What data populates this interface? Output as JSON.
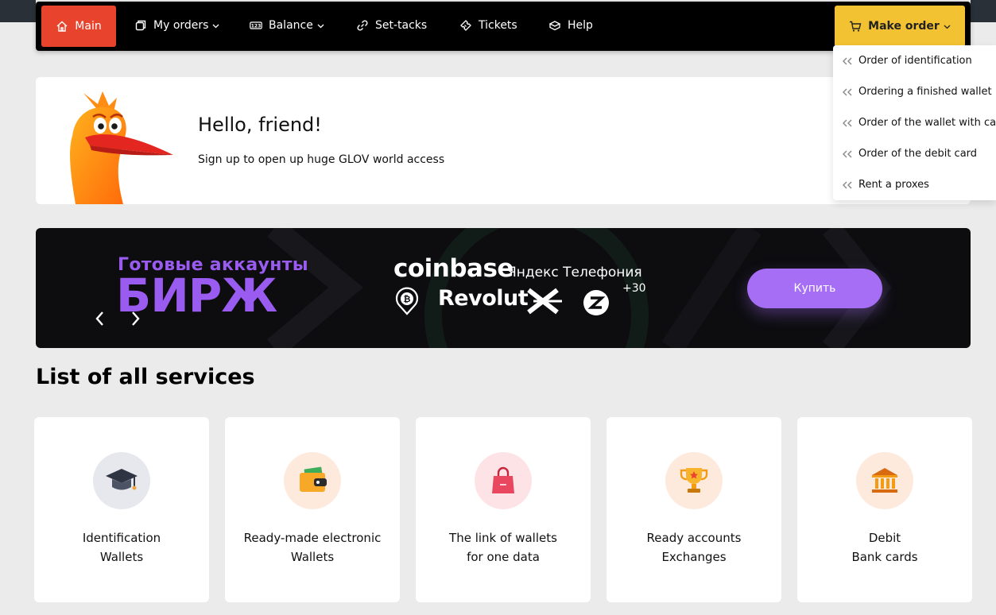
{
  "nav": {
    "main": "Main",
    "my_orders": "My orders",
    "balance": "Balance",
    "set_tacks": "Set-tacks",
    "tickets": "Tickets",
    "help": "Help",
    "make_order": "Make order"
  },
  "dropdown": {
    "items": [
      {
        "label": "Order of identification"
      },
      {
        "label": "Ordering a finished wallet"
      },
      {
        "label": "Order of the wallet with ca"
      },
      {
        "label": "Order of the debit card"
      },
      {
        "label": "Rent a proxes"
      }
    ]
  },
  "hello": {
    "title": "Hello, friend!",
    "subtitle": "Sign up to open up huge GLOV world access"
  },
  "banner": {
    "line1": "Готовые аккаунты",
    "line2": "БИРЖ",
    "brand1": "coinbase",
    "brand2": "Яндекс Телефония",
    "brand3": "Revolut",
    "more": "+30",
    "buy": "Купить"
  },
  "services": {
    "title": "List of all services",
    "items": [
      {
        "line1": "Identification",
        "line2": "Wallets",
        "icon": "graduation-cap-icon",
        "bg": "#e6e8ee"
      },
      {
        "line1": "Ready-made electronic",
        "line2": "Wallets",
        "icon": "wallet-icon",
        "bg": "#fdeadd"
      },
      {
        "line1": "The link of wallets",
        "line2": "for one data",
        "icon": "shopping-bag-icon",
        "bg": "#fde3e6"
      },
      {
        "line1": "Ready accounts",
        "line2": "Exchanges",
        "icon": "trophy-icon",
        "bg": "#fdeadd"
      },
      {
        "line1": "Debit",
        "line2": "Bank cards",
        "icon": "bank-icon",
        "bg": "#fdeadd"
      }
    ]
  },
  "colors": {
    "accent_red": "#e8432d",
    "accent_yellow": "#f2c232",
    "banner_purple": "#9a5cf0",
    "button_purple": "#a66ef5"
  }
}
